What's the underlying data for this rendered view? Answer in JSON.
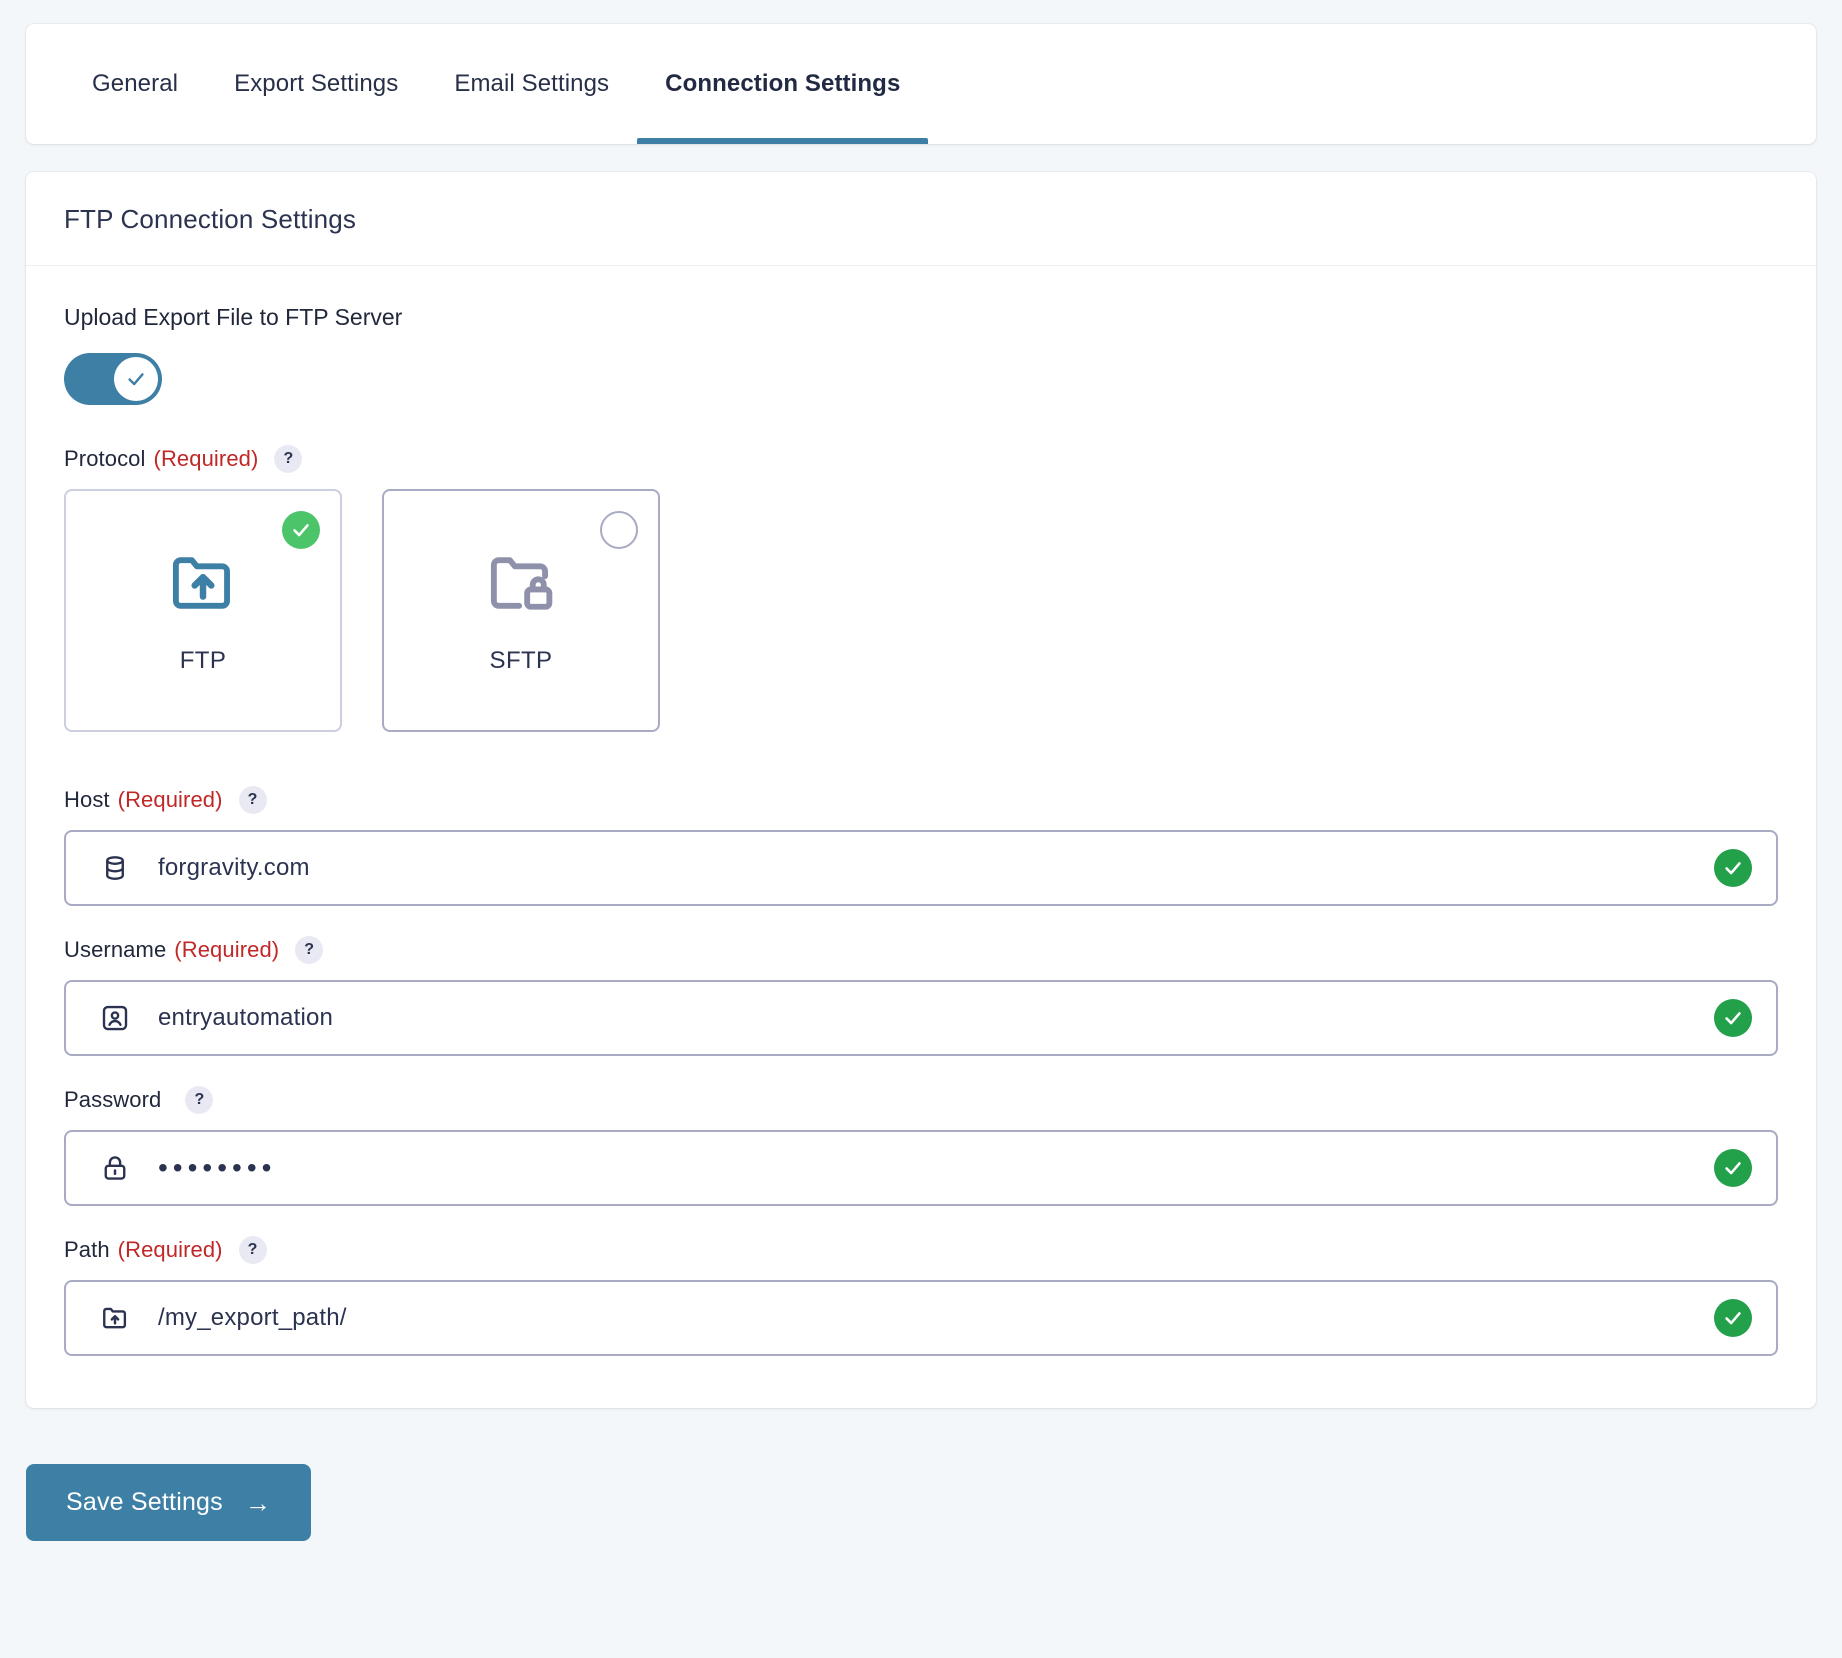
{
  "tabs": [
    {
      "label": "General",
      "active": false
    },
    {
      "label": "Export Settings",
      "active": false
    },
    {
      "label": "Email Settings",
      "active": false
    },
    {
      "label": "Connection Settings",
      "active": true
    }
  ],
  "card": {
    "title": "FTP Connection Settings"
  },
  "upload_toggle": {
    "label": "Upload Export File to FTP Server",
    "state": "on",
    "icon": "check-icon"
  },
  "protocol": {
    "label": "Protocol",
    "required_text": "(Required)",
    "help": "?",
    "options": [
      {
        "name": "FTP",
        "icon": "folder-upload-icon",
        "selected": true,
        "indicator": "check-circle-icon"
      },
      {
        "name": "SFTP",
        "icon": "folder-lock-icon",
        "selected": false,
        "indicator": "radio-empty-icon"
      }
    ]
  },
  "fields": [
    {
      "label": "Host",
      "required_text": "(Required)",
      "help": "?",
      "icon": "database-icon",
      "value": "forgravity.com",
      "placeholder": "forgravity.com",
      "status": "valid",
      "status_icon": "check-circle-icon"
    },
    {
      "label": "Username",
      "required_text": "(Required)",
      "help": "?",
      "icon": "user-icon",
      "value": "entryautomation",
      "placeholder": "entryautomation",
      "status": "valid",
      "status_icon": "check-circle-icon"
    },
    {
      "label": "Password",
      "required_text": "",
      "help": "?",
      "icon": "lock-icon",
      "value": "••••••••",
      "placeholder": "Password",
      "status": "valid",
      "status_icon": "check-circle-icon"
    },
    {
      "label": "Path",
      "required_text": "(Required)",
      "help": "?",
      "icon": "folder-upload-icon",
      "value": "/my_export_path/",
      "placeholder": "/my_export_path/",
      "status": "valid",
      "status_icon": "check-circle-icon"
    }
  ],
  "save": {
    "label": "Save Settings",
    "arrow": "→",
    "icon": "arrow-right-icon"
  },
  "colors": {
    "page_background": "#f4f7fa",
    "accent_blue": "#3e7fa6",
    "required_red": "#c02828",
    "valid_green": "#22a04a",
    "select_green": "#4cc46a",
    "text_navy": "#2b3350",
    "border_gray": "#a9aac4"
  }
}
